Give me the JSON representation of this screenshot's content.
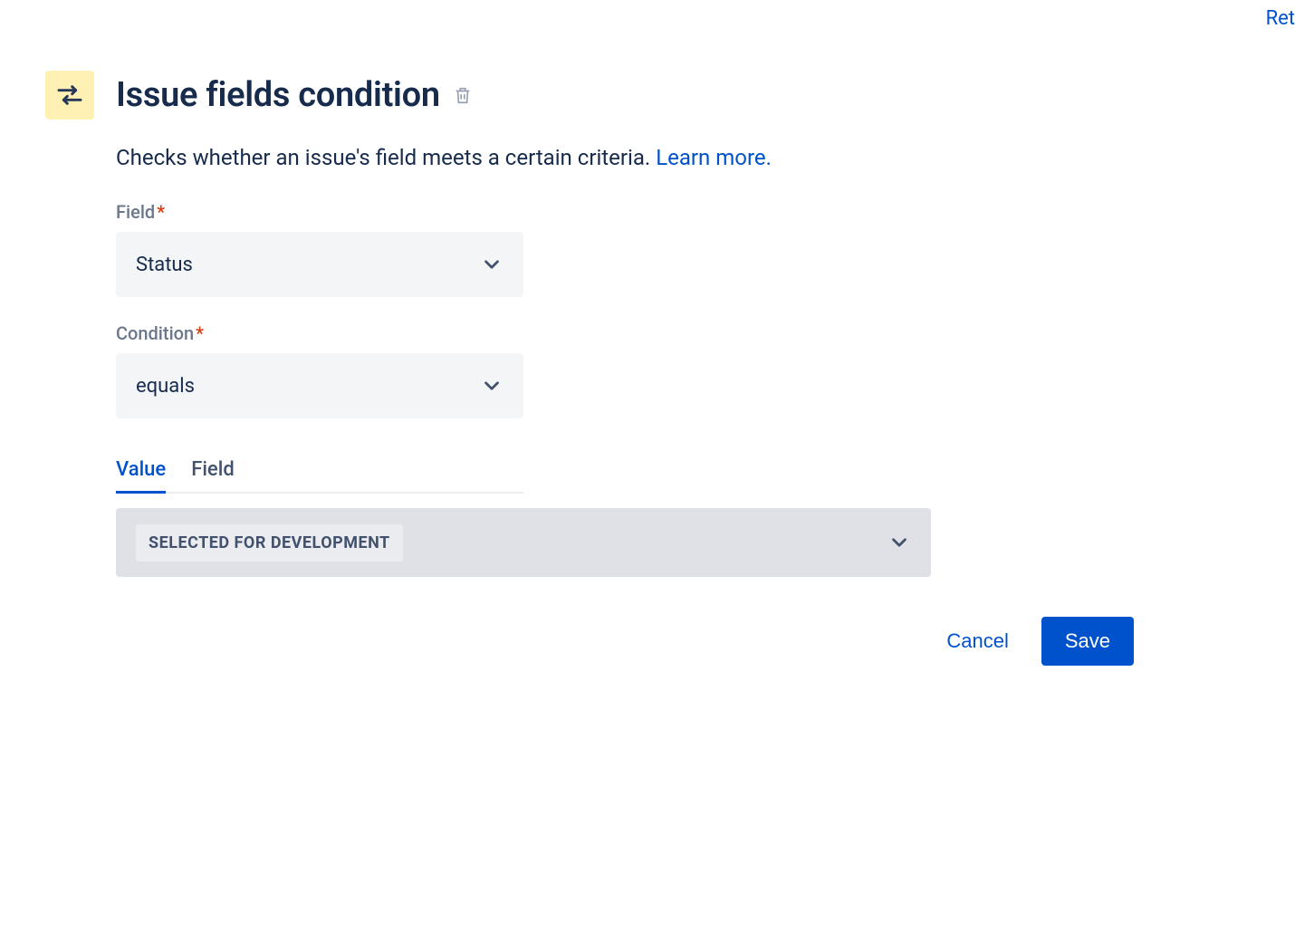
{
  "top_link": "Ret",
  "header": {
    "title": "Issue fields condition"
  },
  "description": {
    "text": "Checks whether an issue's field meets a certain criteria. ",
    "link_text": "Learn more."
  },
  "fields": {
    "field": {
      "label": "Field",
      "value": "Status"
    },
    "condition": {
      "label": "Condition",
      "value": "equals"
    }
  },
  "tabs": {
    "value": "Value",
    "field": "Field"
  },
  "value_select": {
    "selected": "SELECTED FOR DEVELOPMENT"
  },
  "actions": {
    "cancel": "Cancel",
    "save": "Save"
  }
}
